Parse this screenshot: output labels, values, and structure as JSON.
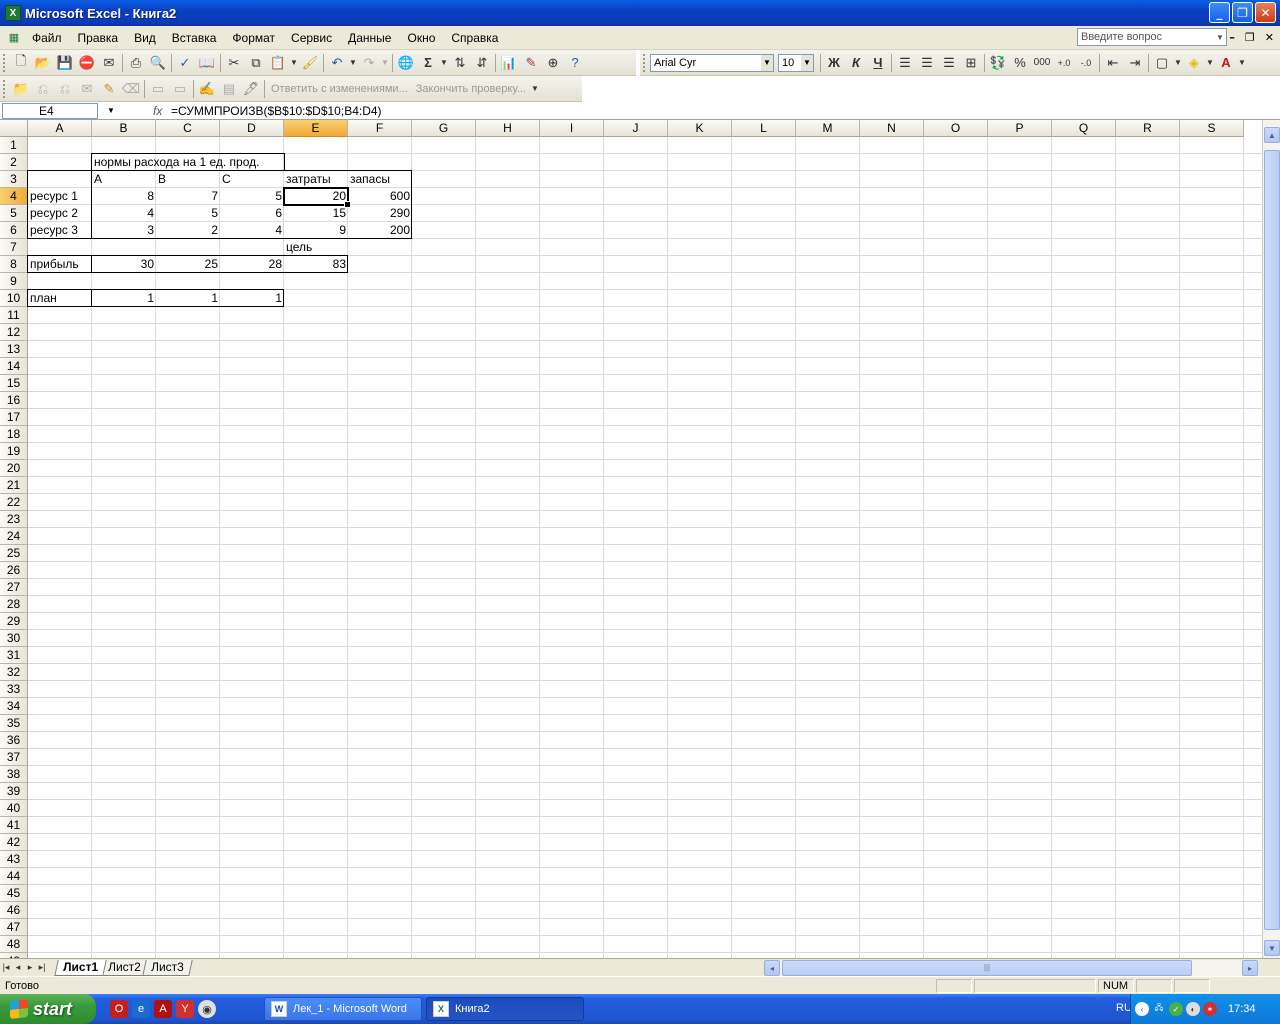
{
  "window": {
    "title": "Microsoft Excel - Книга2",
    "minimize": "_",
    "restore": "❐",
    "close": "✕"
  },
  "menu": {
    "items": [
      "Файл",
      "Правка",
      "Вид",
      "Вставка",
      "Формат",
      "Сервис",
      "Данные",
      "Окно",
      "Справка"
    ],
    "ask_placeholder": "Введите вопрос"
  },
  "format_toolbar": {
    "font_name": "Arial Cyr",
    "font_size": "10",
    "bold": "Ж",
    "italic": "К",
    "underline": "Ч",
    "percent": "%",
    "thousands": "000"
  },
  "review_toolbar": {
    "reply": "Ответить с изменениями...",
    "end_review": "Закончить проверку..."
  },
  "formula_bar": {
    "name_box": "E4",
    "fx": "fx",
    "formula": "=СУММПРОИЗВ($B$10:$D$10;B4:D4)"
  },
  "columns": [
    "A",
    "B",
    "C",
    "D",
    "E",
    "F",
    "G",
    "H",
    "I",
    "J",
    "K",
    "L",
    "M",
    "N",
    "O",
    "P",
    "Q",
    "R",
    "S"
  ],
  "selected_column": "E",
  "selected_row": 4,
  "sheet": {
    "r2_header": "нормы расхода на 1 ед. прод.",
    "r3": {
      "b": "A",
      "c": "B",
      "d": "C",
      "e": "затраты",
      "f": "запасы"
    },
    "r4": {
      "a": "ресурс 1",
      "b": "8",
      "c": "7",
      "d": "5",
      "e": "20",
      "f": "600"
    },
    "r5": {
      "a": "ресурс 2",
      "b": "4",
      "c": "5",
      "d": "6",
      "e": "15",
      "f": "290"
    },
    "r6": {
      "a": "ресурс 3",
      "b": "3",
      "c": "2",
      "d": "4",
      "e": "9",
      "f": "200"
    },
    "r7": {
      "e": "цель"
    },
    "r8": {
      "a": "прибыль",
      "b": "30",
      "c": "25",
      "d": "28",
      "e": "83"
    },
    "r10": {
      "a": "план",
      "b": "1",
      "c": "1",
      "d": "1"
    }
  },
  "tabs": [
    "Лист1",
    "Лист2",
    "Лист3"
  ],
  "active_tab": "Лист1",
  "status": {
    "text": "Готово",
    "num": "NUM"
  },
  "taskbar": {
    "start": "start",
    "items": [
      "Лек_1 - Microsoft Word",
      "Книга2"
    ],
    "lang": "RU",
    "clock": "17:34"
  }
}
